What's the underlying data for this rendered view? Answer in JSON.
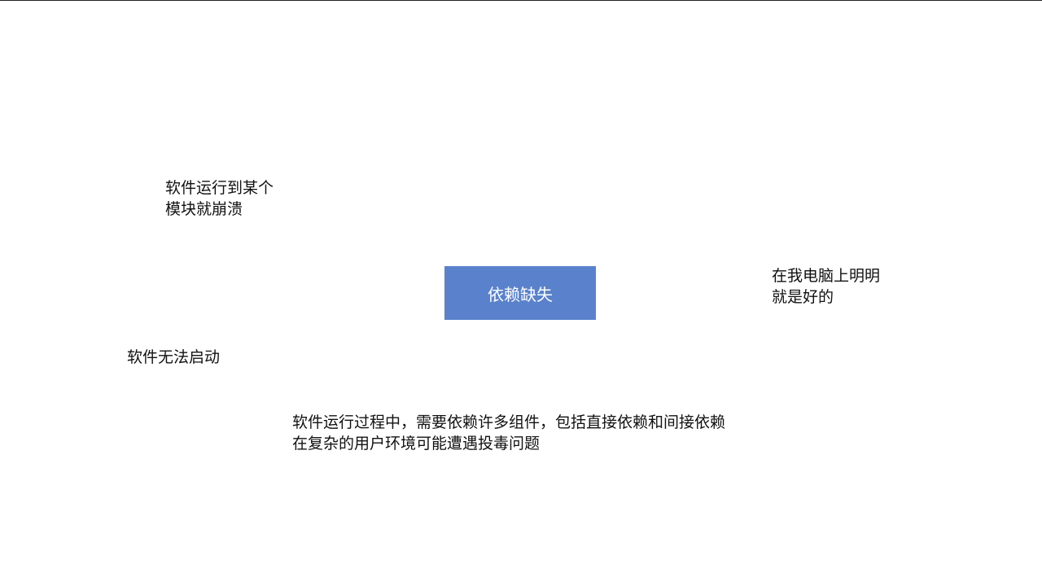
{
  "center": {
    "label": "依赖缺失",
    "fill_color": "#5a82cc",
    "text_color": "#ffffff"
  },
  "notes": {
    "module_crash": {
      "lines": [
        "软件运行到某个",
        "模块就崩溃"
      ]
    },
    "works_on_my_machine": {
      "lines": [
        "在我电脑上明明",
        "就是好的"
      ]
    },
    "cannot_start": {
      "lines": [
        "软件无法启动"
      ]
    },
    "explanation": {
      "lines": [
        "软件运行过程中，需要依赖许多组件，包括直接依赖和间接依赖",
        "在复杂的用户环境可能遭遇投毒问题"
      ]
    }
  }
}
